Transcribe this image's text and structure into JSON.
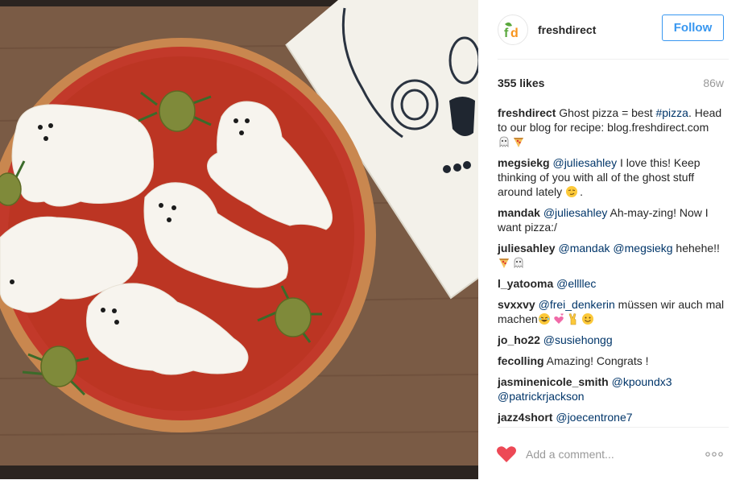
{
  "header": {
    "avatar_text": "fd",
    "username": "freshdirect",
    "follow_label": "Follow"
  },
  "stats": {
    "likes": "355 likes",
    "age": "86w"
  },
  "caption": {
    "user": "freshdirect",
    "text_before": " Ghost pizza = best ",
    "hashtag": "#pizza",
    "text_after": ". Head to our blog for recipe: blog.freshdirect.com",
    "emoji": [
      "ghost-emoji",
      "pizza-emoji"
    ]
  },
  "comments": [
    {
      "user": "megsiekg",
      "mention": "@juliesahley",
      "text": " I love this! Keep thinking of you with all of the ghost stuff around lately ",
      "emoji_tail": [
        "smirk-emoji"
      ],
      "suffix": "."
    },
    {
      "user": "mandak",
      "mention": "@juliesahley",
      "text": " Ah-may-zing! Now I want pizza:/"
    },
    {
      "user": "juliesahley",
      "mention": "@mandak",
      "mention2": "@megsiekg",
      "text": " hehehe!! ",
      "emoji_tail": [
        "pizza-emoji",
        "ghost-emoji"
      ]
    },
    {
      "user": "l_yatooma",
      "mention": "@ellllec",
      "text": ""
    },
    {
      "user": "svxxvy",
      "mention": "@frei_denkerin",
      "text": " müssen wir auch mal machen",
      "emoji_tail": [
        "laughing-emoji",
        "hearts-emoji",
        "victory-hand-emoji",
        "smile-emoji"
      ]
    },
    {
      "user": "jo_ho22",
      "mention": "@susiehongg",
      "text": ""
    },
    {
      "user": "fecolling",
      "text": " Amazing! Congrats !"
    },
    {
      "user": "jasminenicole_smith",
      "mention": "@kpoundx3",
      "mention2": "@patrickrjackson",
      "text": ""
    },
    {
      "user": "jazz4short",
      "mention": "@joecentrone7",
      "text": ""
    }
  ],
  "footer": {
    "comment_placeholder": "Add a comment...",
    "more_label": "more-options"
  },
  "colors": {
    "accent": "#3897f0",
    "mention": "#003569",
    "heart": "#ed4956",
    "brand_green": "#5aa83d",
    "brand_orange": "#f7941d"
  }
}
